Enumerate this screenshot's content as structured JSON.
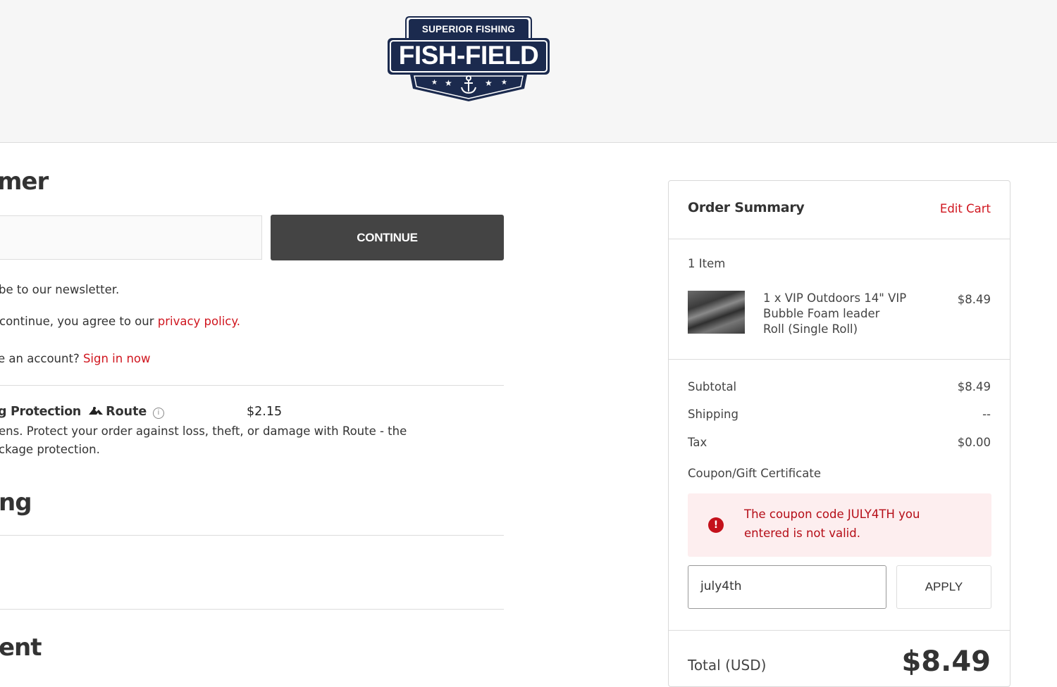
{
  "brand": {
    "top_text": "SUPERIOR FISHING",
    "name": "FISH-FIELD",
    "colors": {
      "navy": "#1b2a4e",
      "accent_red": "#d0161f",
      "button_dark": "#444444"
    }
  },
  "customer": {
    "heading": "mer",
    "continue_label": "CONTINUE",
    "newsletter_text": "be to our newsletter.",
    "privacy_prefix": "continue, you agree to our ",
    "privacy_link": "privacy policy",
    "privacy_suffix": ".",
    "account_prefix": "e an account? ",
    "signin_link": "Sign in now"
  },
  "route": {
    "title": "g Protection",
    "brand": "Route",
    "price": "$2.15",
    "desc_line1": "ens. Protect your order against loss, theft, or damage with Route - the",
    "desc_line2": "ckage protection."
  },
  "shipping": {
    "heading": "ng"
  },
  "payment": {
    "heading": "ent"
  },
  "summary": {
    "title": "Order Summary",
    "edit_cart": "Edit Cart",
    "item_count": "1 Item",
    "item": {
      "line1": "1 x VIP Outdoors 14\" VIP",
      "line2": "Bubble Foam leader",
      "line3": "Roll (Single Roll)",
      "price": "$8.49"
    },
    "subtotal_label": "Subtotal",
    "subtotal_value": "$8.49",
    "shipping_label": "Shipping",
    "shipping_value": "--",
    "tax_label": "Tax",
    "tax_value": "$0.00",
    "coupon_label": "Coupon/Gift Certificate",
    "coupon_error_line1": "The coupon code JULY4TH you",
    "coupon_error_line2": "entered is not valid.",
    "coupon_value": "july4th",
    "apply_label": "APPLY",
    "total_label": "Total (USD)",
    "total_value": "$8.49"
  }
}
